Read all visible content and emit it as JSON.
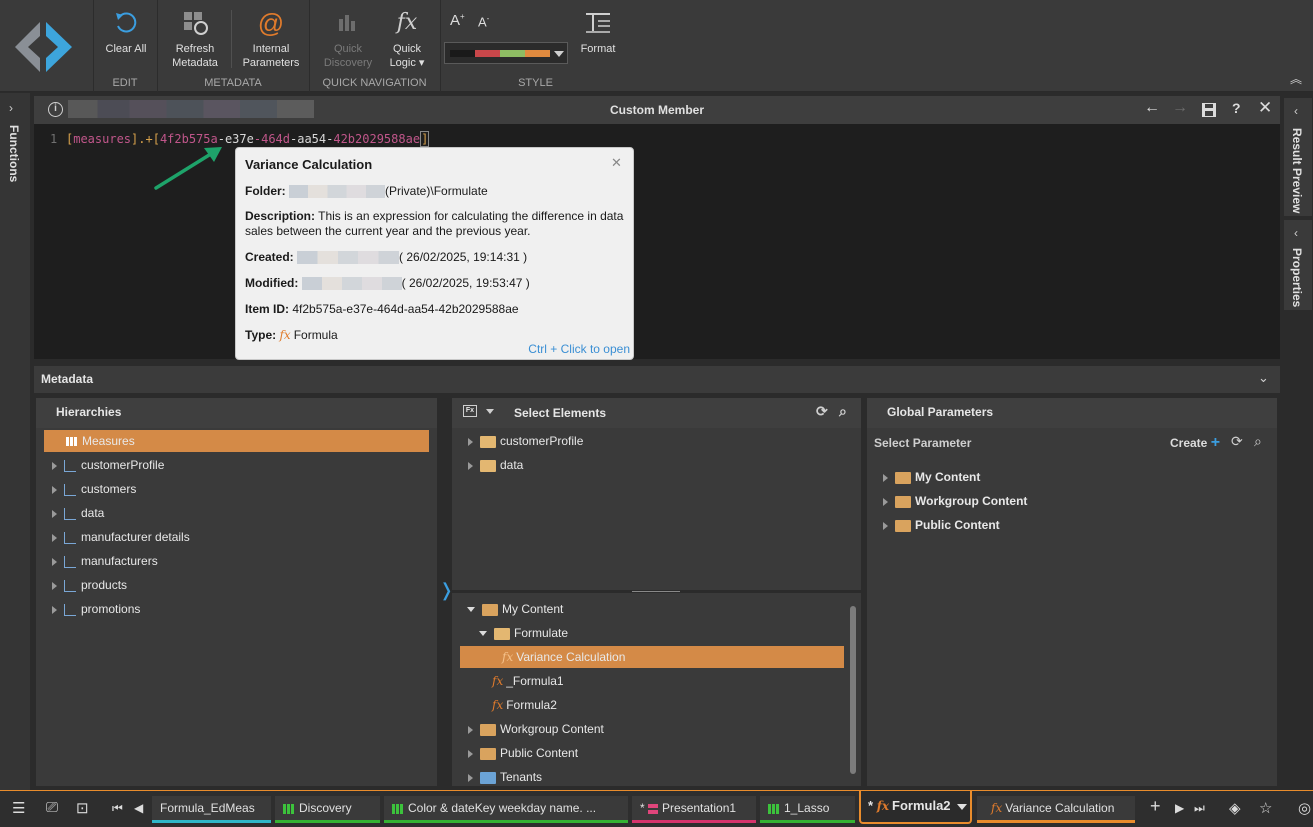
{
  "ribbon": {
    "edit": {
      "clear_all": "Clear All",
      "group": "EDIT"
    },
    "metadata": {
      "refresh": "Refresh\nMetadata",
      "refresh_l1": "Refresh",
      "refresh_l2": "Metadata",
      "internal_l1": "Internal",
      "internal_l2": "Parameters",
      "group": "METADATA"
    },
    "quick_nav": {
      "discovery_l1": "Quick",
      "discovery_l2": "Discovery",
      "logic_l1": "Quick",
      "logic_l2": "Logic ▾",
      "group": "QUICK NAVIGATION"
    },
    "style": {
      "font_up": "A",
      "font_down": "A",
      "format": "Format",
      "group": "STYLE",
      "palette": [
        "#1a1a1a",
        "#c9474a",
        "#8ebc63",
        "#e08a3f"
      ]
    }
  },
  "left_sidebar": {
    "functions": "Functions"
  },
  "right_sidebar": {
    "result_preview": "Result Preview",
    "properties": "Properties"
  },
  "editor": {
    "title": "Custom Member",
    "line_number": "1",
    "code": {
      "p1": "[",
      "p2": "measures",
      "p3": "].+[",
      "p4": "4f2b575a",
      "p5": "-e3",
      "p6": "7e",
      "p7": "-464d",
      "p8": "-aa54-",
      "p9": "42b2029588ae",
      "p10": "]"
    }
  },
  "tooltip": {
    "title": "Variance Calculation",
    "folder_label": "Folder:",
    "folder_value": "(Private)\\Formulate",
    "description_label": "Description:",
    "description_value": "This is an expression for calculating the difference in data sales between the current year and the previous year.",
    "created_label": "Created:",
    "created_value": "( 26/02/2025, 19:14:31 )",
    "modified_label": "Modified:",
    "modified_value": "( 26/02/2025, 19:53:47 )",
    "itemid_label": "Item ID:",
    "itemid_value": "4f2b575a-e37e-464d-aa54-42b2029588ae",
    "type_label": "Type:",
    "type_value": "Formula",
    "footer": "Ctrl + Click to open"
  },
  "metadata": {
    "title": "Metadata",
    "hierarchies": {
      "title": "Hierarchies",
      "items": [
        "Measures",
        "customerProfile",
        "customers",
        "data",
        "manufacturer details",
        "manufacturers",
        "products",
        "promotions"
      ]
    },
    "select_elements": {
      "title": "Select Elements",
      "top_items": [
        "customerProfile",
        "data"
      ],
      "content": {
        "my_content": "My Content",
        "formulate": "Formulate",
        "variance": "Variance Calculation",
        "formula1": "_Formula1",
        "formula2": "Formula2",
        "workgroup": "Workgroup Content",
        "public": "Public Content",
        "tenants": "Tenants"
      }
    },
    "global_parameters": {
      "title": "Global Parameters",
      "select_param": "Select Parameter",
      "create": "Create",
      "items": [
        "My Content",
        "Workgroup Content",
        "Public Content"
      ]
    }
  },
  "bottom_tabs": [
    {
      "label": "Formula_EdMeas",
      "color": "#2fb7c8"
    },
    {
      "label": "Discovery",
      "color": "#34b233"
    },
    {
      "label": "Color & dateKey weekday name. ...",
      "color": "#34b233"
    },
    {
      "label": "Presentation1",
      "prefix": "*",
      "color": "#d6336c"
    },
    {
      "label": "1_Lasso",
      "color": "#34b233"
    },
    {
      "label": "Formula2",
      "prefix": "*",
      "color": "#e98c2c"
    },
    {
      "label": "Variance Calculation",
      "color": "#e98c2c"
    }
  ]
}
